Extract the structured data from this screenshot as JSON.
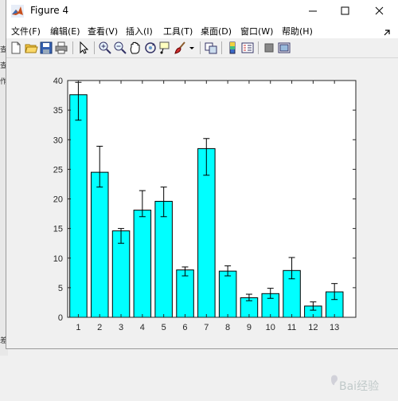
{
  "window": {
    "title": "Figure 4",
    "min_icon": "minimize-icon",
    "max_icon": "maximize-icon",
    "close_icon": "close-icon"
  },
  "menu": [
    {
      "label": "文件(F)"
    },
    {
      "label": "编辑(E)"
    },
    {
      "label": "查看(V)"
    },
    {
      "label": "插入(I)"
    },
    {
      "label": "工具(T)"
    },
    {
      "label": "桌面(D)"
    },
    {
      "label": "窗口(W)"
    },
    {
      "label": "帮助(H)"
    }
  ],
  "toolbar": [
    "new-figure-icon",
    "open-file-icon",
    "save-icon",
    "print-icon",
    "edit-plot-arrow-icon",
    "zoom-in-icon",
    "zoom-out-icon",
    "pan-hand-icon",
    "rotate-3d-icon",
    "data-cursor-icon",
    "brush-icon",
    "brush-dropdown-icon",
    "link-plot-icon",
    "insert-colorbar-icon",
    "insert-legend-icon",
    "hide-plot-tools-icon",
    "show-plot-tools-icon"
  ],
  "background_labels": [
    "查",
    "查",
    "作",
    "差"
  ],
  "watermark_text": "Bai经验",
  "colors": {
    "bar_fill": "#00ffff",
    "bar_stroke": "#000000",
    "errorbar": "#000000",
    "axes_bg": "#ffffff"
  },
  "chart_data": {
    "type": "bar",
    "categories": [
      "1",
      "2",
      "3",
      "4",
      "5",
      "6",
      "7",
      "8",
      "9",
      "10",
      "11",
      "12",
      "13"
    ],
    "values": [
      37.6,
      24.5,
      14.6,
      18.1,
      19.6,
      8.0,
      28.5,
      7.8,
      3.3,
      4.0,
      7.9,
      1.9,
      4.3
    ],
    "error_low": [
      33.3,
      22.0,
      12.5,
      17.0,
      17.0,
      7.0,
      24.0,
      7.0,
      2.8,
      3.2,
      6.5,
      1.2,
      3.0
    ],
    "error_high": [
      39.7,
      28.9,
      15.0,
      21.4,
      22.0,
      8.5,
      30.2,
      8.7,
      3.9,
      4.9,
      10.1,
      2.6,
      5.7
    ],
    "xlabel": "",
    "ylabel": "",
    "ylim": [
      0,
      40
    ],
    "yticks": [
      "0",
      "5",
      "10",
      "15",
      "20",
      "25",
      "30",
      "35",
      "40"
    ],
    "grid": false
  }
}
